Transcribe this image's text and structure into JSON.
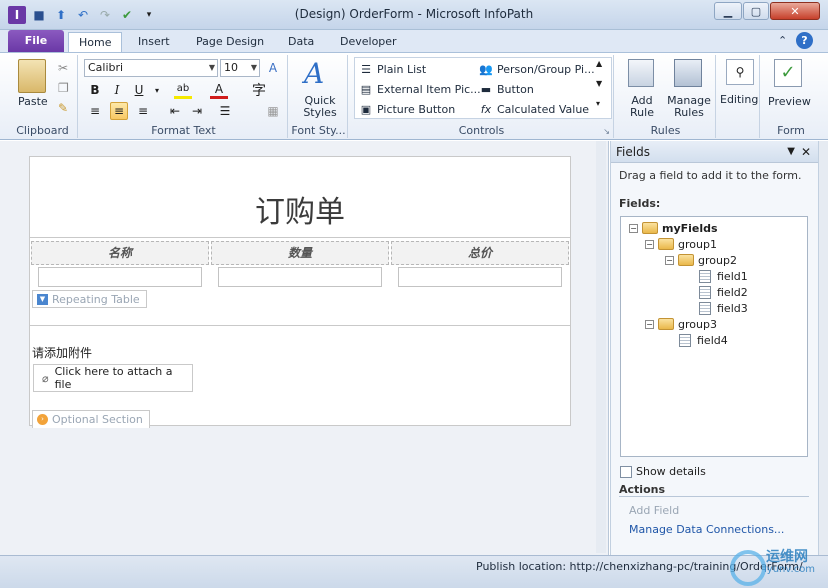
{
  "window": {
    "title": "(Design) OrderForm - Microsoft InfoPath"
  },
  "tabs": [
    {
      "label": "File"
    },
    {
      "label": "Home"
    },
    {
      "label": "Insert"
    },
    {
      "label": "Page Design"
    },
    {
      "label": "Data"
    },
    {
      "label": "Developer"
    }
  ],
  "ribbon": {
    "clipboard": {
      "paste_label": "Paste",
      "group_label": "Clipboard"
    },
    "format_text": {
      "font": "Calibri",
      "size": "10",
      "group_label": "Format Text"
    },
    "font_styles": {
      "quick_styles_label": "Quick Styles",
      "group_label": "Font Sty..."
    },
    "controls": {
      "items": [
        "Plain List",
        "External Item Pic...",
        "Picture Button",
        "Person/Group Pi...",
        "Button",
        "Calculated Value"
      ],
      "group_label": "Controls"
    },
    "rules": {
      "add_rule_label": "Add Rule",
      "manage_rules_label": "Manage Rules",
      "group_label": "Rules"
    },
    "editing": {
      "label": "Editing"
    },
    "form": {
      "preview_label": "Preview",
      "group_label": "Form"
    }
  },
  "form": {
    "title": "订购单",
    "columns": [
      "名称",
      "数量",
      "总价"
    ],
    "repeating_table_tag": "Repeating Table",
    "attach_prompt": "请添加附件",
    "attach_button": "Click here to attach a file",
    "optional_section_tag": "Optional Section"
  },
  "fields_pane": {
    "title": "Fields",
    "hint": "Drag a field to add it to the form.",
    "fields_label": "Fields:",
    "tree": [
      {
        "label": "myFields",
        "type": "folder",
        "level": 0
      },
      {
        "label": "group1",
        "type": "folder",
        "level": 1
      },
      {
        "label": "group2",
        "type": "folder",
        "level": 2
      },
      {
        "label": "field1",
        "type": "field",
        "level": 3
      },
      {
        "label": "field2",
        "type": "field",
        "level": 3
      },
      {
        "label": "field3",
        "type": "field",
        "level": 3
      },
      {
        "label": "group3",
        "type": "folder",
        "level": 1
      },
      {
        "label": "field4",
        "type": "field",
        "level": 2
      }
    ],
    "show_details": "Show details",
    "actions_label": "Actions",
    "add_field": "Add Field",
    "manage_connections": "Manage Data Connections..."
  },
  "status": {
    "publish_location": "Publish location: http://chenxizhang-pc/training/OrderForm/"
  },
  "watermark": {
    "text": "运维网",
    "sub": "iyunv.com"
  },
  "colors": {
    "file_tab": "#6a38a6",
    "accent": "#1f56a8"
  }
}
